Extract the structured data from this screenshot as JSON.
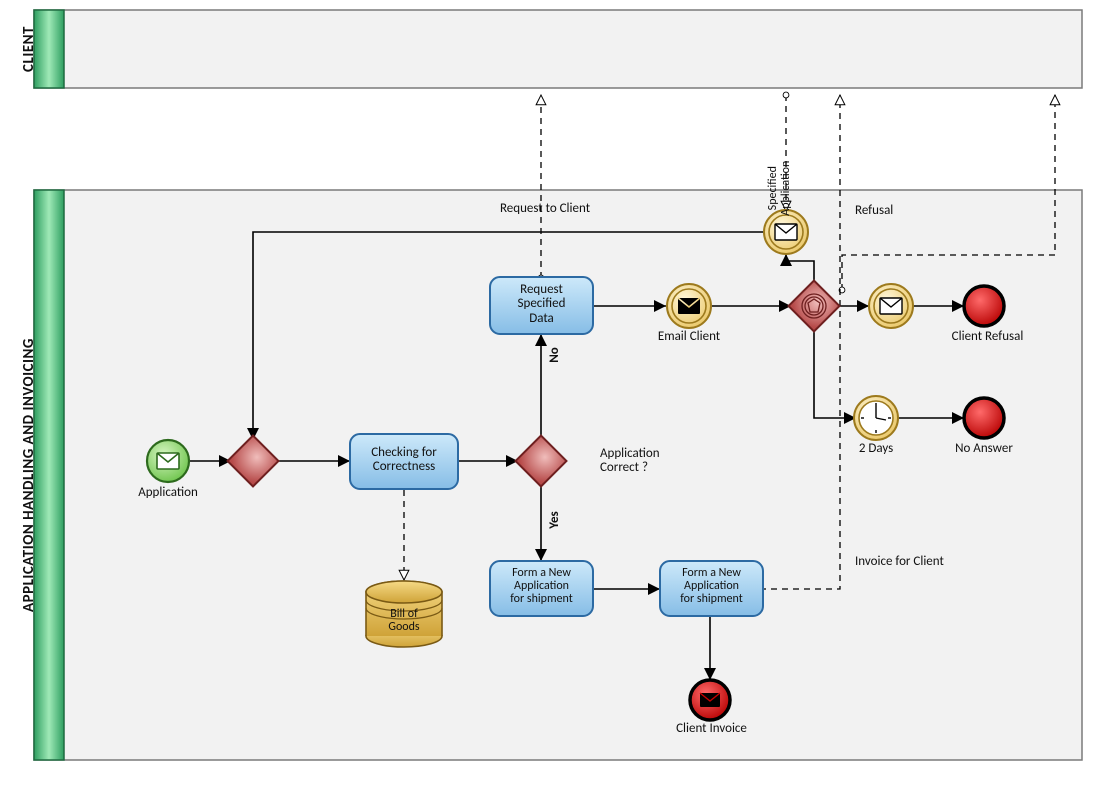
{
  "pools": {
    "client": {
      "title": "CLIENT"
    },
    "app": {
      "title": "APPLICATION HANDLING AND INVOICING"
    }
  },
  "events": {
    "start_application": "Application",
    "msg_catch_specified": "",
    "msg_throw_request": "",
    "msg_throw_refusal": "",
    "email_client": "Email Client",
    "timer_two_days": "2 Days",
    "end_client_refusal": "Client Refusal",
    "end_no_answer": "No Answer",
    "end_client_invoice": "Client Invoice"
  },
  "tasks": {
    "checking": "Checking for\nCorrectness",
    "request_specified": "Request\nSpecified\nData",
    "form_shipment_1": "Form a New\nApplication\nfor shipment",
    "form_shipment_2": "Form a New\nApplication\nfor shipment"
  },
  "gateways": {
    "merge": "",
    "app_correct": "Application\nCorrect ?",
    "event_based": ""
  },
  "data": {
    "bill_of_goods": "Bill of\nGoods"
  },
  "edges": {
    "no": "No",
    "yes": "Yes",
    "request_to_client": "Request to Client",
    "specified_application": "Specified\nApplication",
    "refusal": "Refusal",
    "invoice_for_client": "Invoice for Client"
  },
  "colors": {
    "pool_fill": "#f2f2f2",
    "pool_stroke": "#7a7a7a",
    "pool_title_grad_a": "#2e9e60",
    "pool_title_grad_b": "#8fe1a9",
    "task_fill_a": "#b9dcf7",
    "task_fill_b": "#87bfe8",
    "task_stroke": "#2c6aa3",
    "gateway_fill_a": "#e89b9a",
    "gateway_fill_b": "#b94848",
    "gateway_stroke": "#6e1f1f",
    "start_fill_a": "#bff0a6",
    "start_fill_b": "#6fc74d",
    "start_stroke": "#2d6a1d",
    "inter_fill_a": "#fff0c4",
    "inter_fill_b": "#f2cf6a",
    "inter_stroke": "#9d7a1d",
    "timer_fill": "#ffffff",
    "end_fill_a": "#ff7777",
    "end_fill_b": "#c60000",
    "end_stroke": "#000000",
    "data_fill_a": "#f4cf6a",
    "data_fill_b": "#caa02e",
    "data_stroke": "#7a5a14",
    "line": "#000000"
  }
}
